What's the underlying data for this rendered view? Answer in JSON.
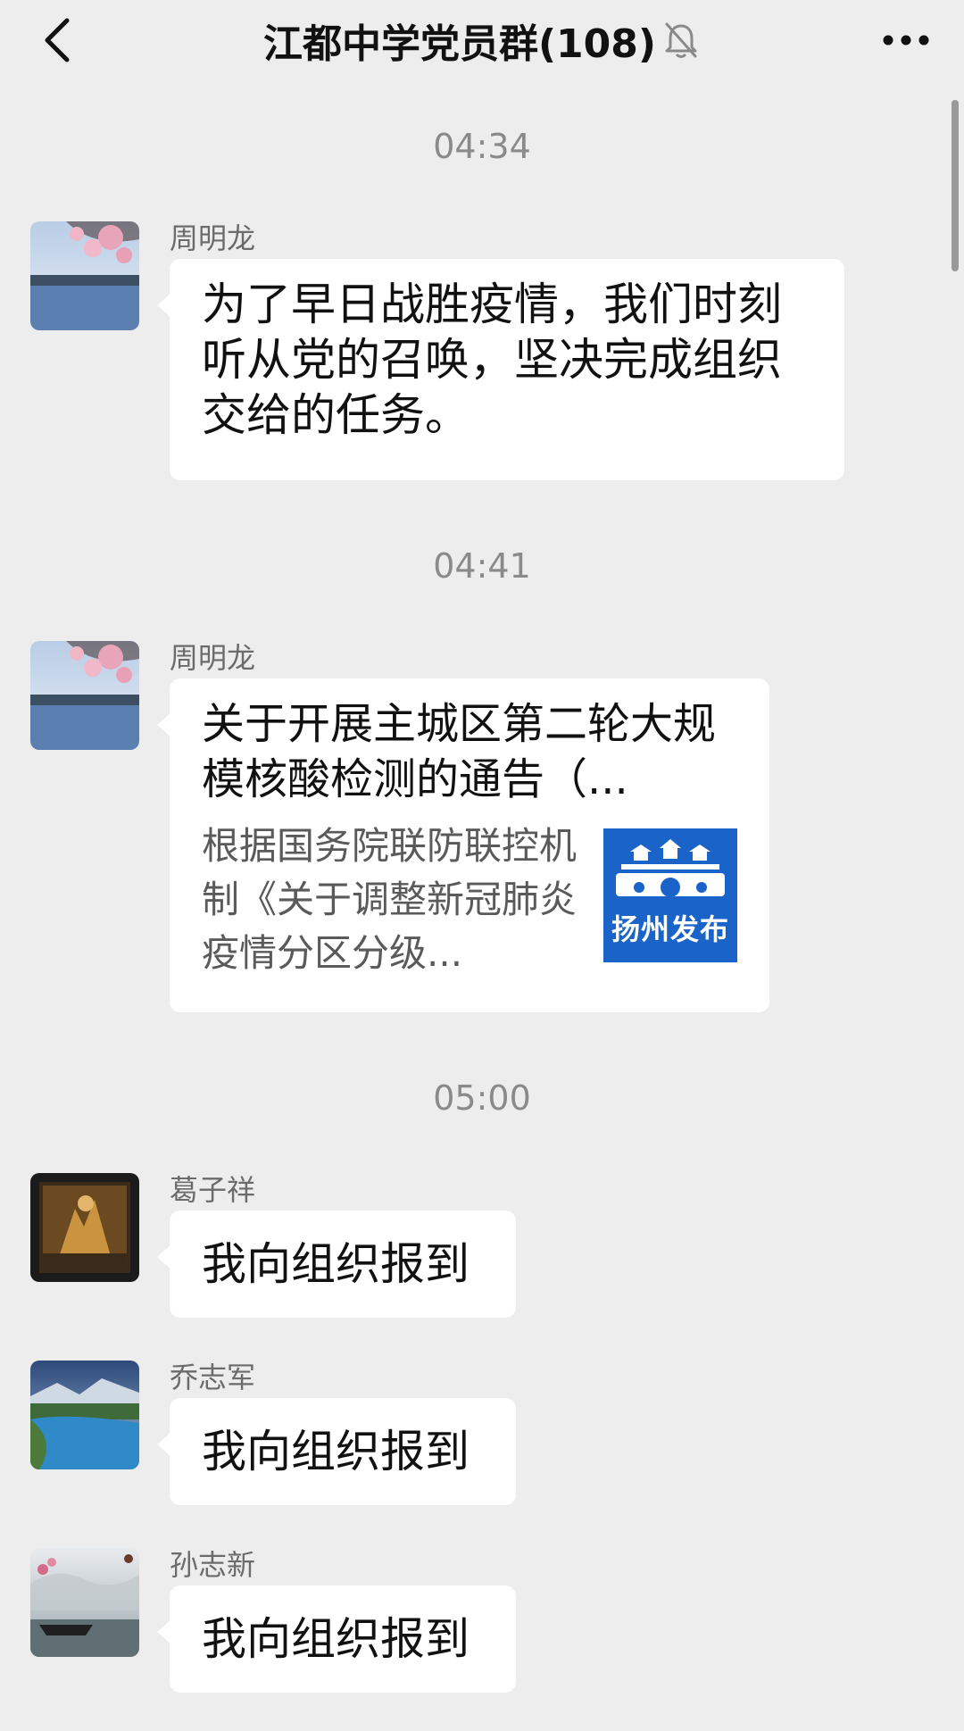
{
  "header": {
    "title": "江都中学党员群(108)",
    "back_icon": "chevron-left-icon",
    "mute_icon": "bell-off-icon",
    "more_icon": "more-horizontal-icon"
  },
  "messages": [
    {
      "time": "04:34",
      "sender": "周明龙",
      "type": "text",
      "text": "为了早日战胜疫情，我们时刻听从党的召唤，坚决完成组织交给的任务。"
    },
    {
      "time": "04:41",
      "sender": "周明龙",
      "type": "link",
      "title": "关于开展主城区第二轮大规模核酸检测的通告（...",
      "description": "根据国务院联防联控机制《关于调整新冠肺炎疫情分区分级...",
      "thumb_label": "扬州发布"
    },
    {
      "time": "05:00",
      "sender": "葛子祥",
      "type": "text",
      "text": "我向组织报到"
    },
    {
      "sender": "乔志军",
      "type": "text",
      "text": "我向组织报到"
    },
    {
      "sender": "孙志新",
      "type": "text",
      "text": "我向组织报到"
    }
  ],
  "colors": {
    "background": "#ededed",
    "bubble": "#ffffff",
    "thumb_brand": "#1a63c9"
  }
}
